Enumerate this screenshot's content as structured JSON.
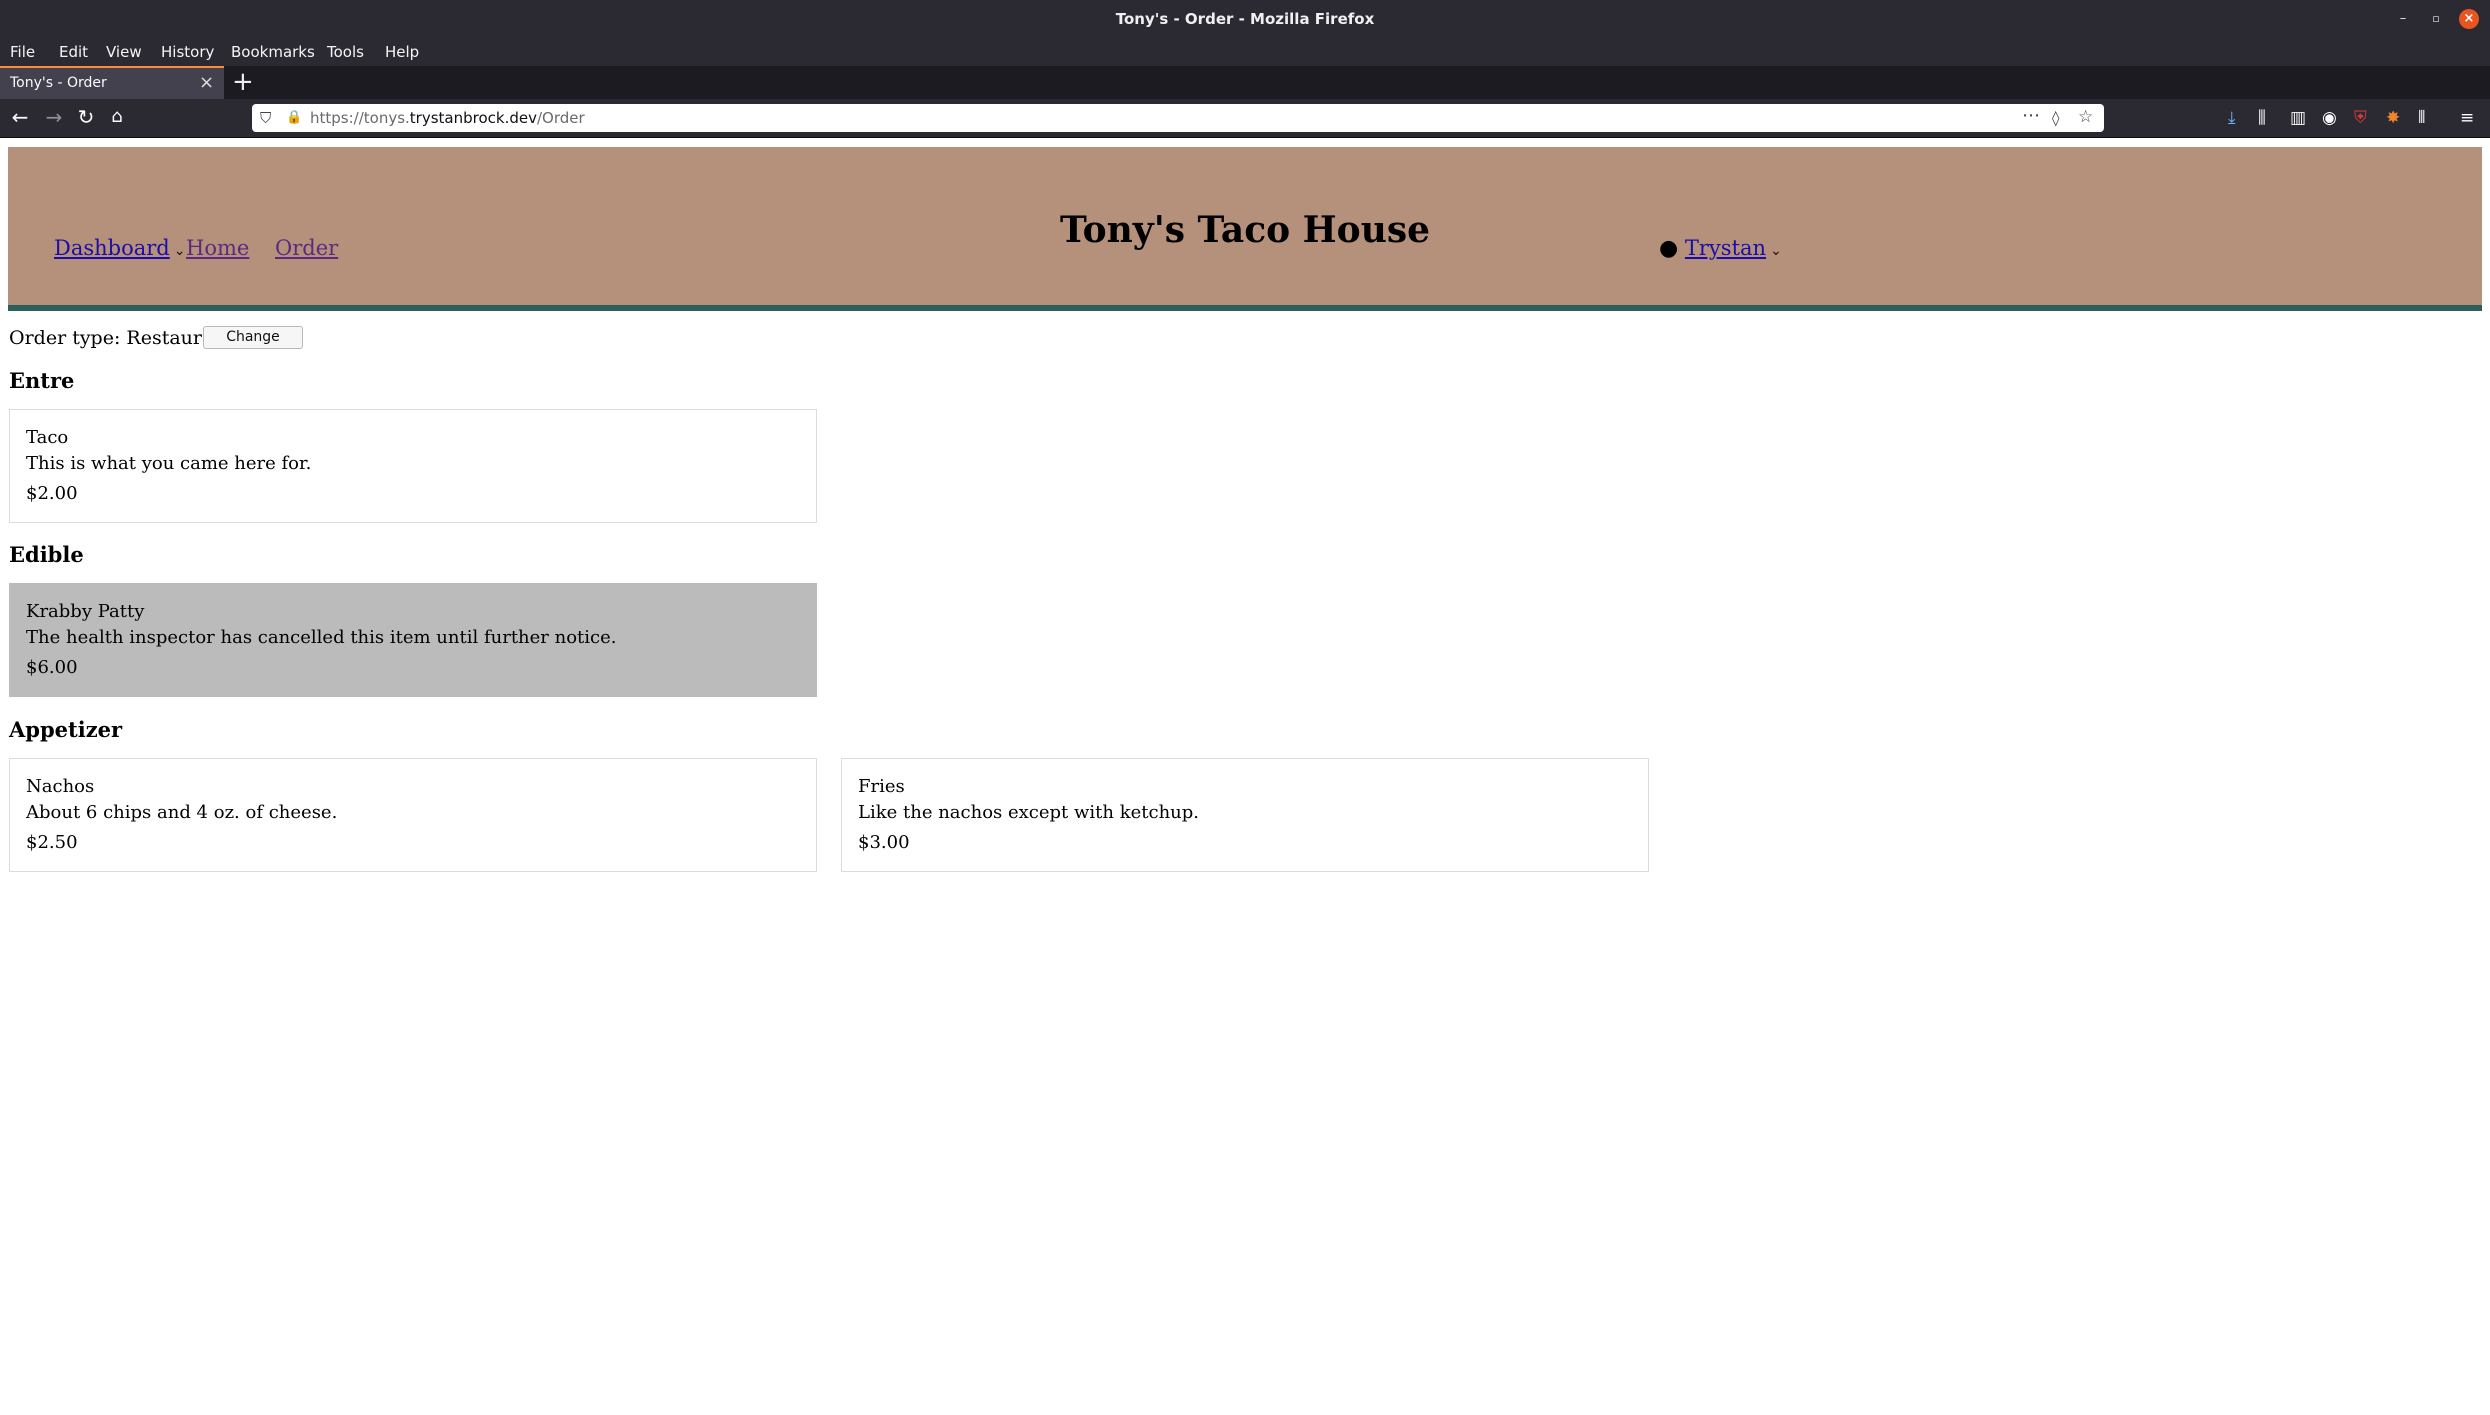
{
  "window": {
    "title": "Tony's - Order - Mozilla Firefox",
    "controls": {
      "minimize": "–",
      "maximize": "▫",
      "close": "×"
    }
  },
  "menubar": {
    "items": [
      "File",
      "Edit",
      "View",
      "History",
      "Bookmarks",
      "Tools",
      "Help"
    ]
  },
  "tabs": [
    {
      "label": "Tony's - Order",
      "active": true
    }
  ],
  "navbar": {
    "url_prefix": "https://tonys.",
    "url_domain": "trystanbrock.dev",
    "url_path": "/Order"
  },
  "site": {
    "title": "Tony's Taco House",
    "nav": {
      "dashboard": "Dashboard",
      "home": "Home",
      "order": "Order"
    },
    "user": "Trystan",
    "header_color": "#b5907a",
    "accent_color": "#2c5e5e"
  },
  "order": {
    "type_label": "Order type: Restaurant",
    "change_label": "Change"
  },
  "sections": [
    {
      "title": "Entre",
      "items": [
        {
          "name": "Taco",
          "description": "This is what you came here for.",
          "price": "$2.00",
          "available": true
        }
      ]
    },
    {
      "title": "Edible",
      "items": [
        {
          "name": "Krabby Patty",
          "description": "The health inspector has cancelled this item until further notice.",
          "price": "$6.00",
          "available": false
        }
      ]
    },
    {
      "title": "Appetizer",
      "items": [
        {
          "name": "Nachos",
          "description": "About 6 chips and 4 oz. of cheese.",
          "price": "$2.50",
          "available": true
        },
        {
          "name": "Fries",
          "description": "Like the nachos except with ketchup.",
          "price": "$3.00",
          "available": true
        }
      ]
    }
  ]
}
